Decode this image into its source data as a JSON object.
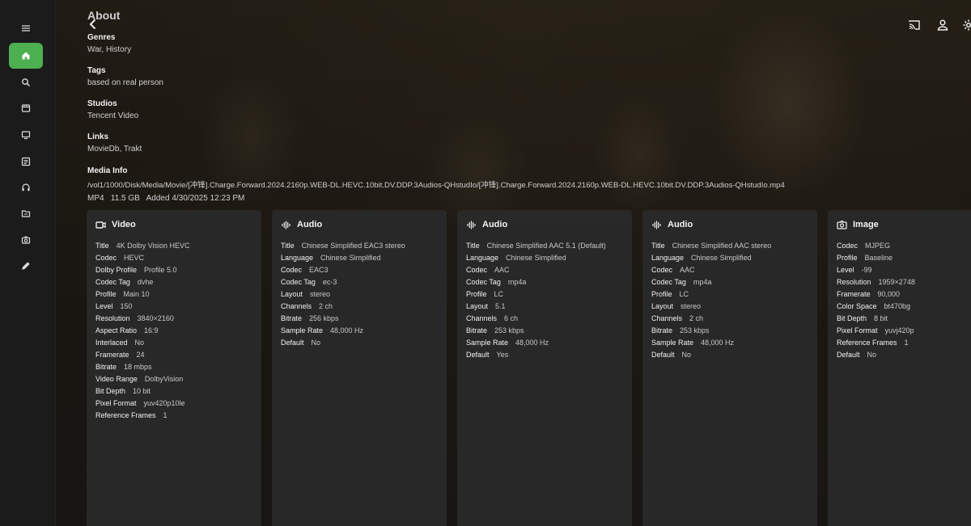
{
  "sidebar": {
    "items": [
      {
        "name": "menu",
        "icon": "menu-icon"
      },
      {
        "name": "home",
        "icon": "home-icon",
        "active": true
      },
      {
        "name": "search",
        "icon": "search-icon"
      },
      {
        "name": "movies",
        "icon": "film-icon"
      },
      {
        "name": "tv",
        "icon": "tv-icon"
      },
      {
        "name": "collections",
        "icon": "list-icon"
      },
      {
        "name": "music",
        "icon": "headphones-icon"
      },
      {
        "name": "folders",
        "icon": "folder-icon"
      },
      {
        "name": "photos",
        "icon": "camera-icon"
      },
      {
        "name": "edit",
        "icon": "pencil-icon"
      }
    ],
    "accent": "#4caf50"
  },
  "header": {
    "title": "About",
    "icons": [
      "cast-icon",
      "user-icon",
      "settings-icon"
    ]
  },
  "about": {
    "genres_label": "Genres",
    "genres_value": "War, History",
    "tags_label": "Tags",
    "tags_value": "based on real person",
    "studios_label": "Studios",
    "studios_value": "Tencent Video",
    "links_label": "Links",
    "links_value": "MovieDb, Trakt",
    "media_info_label": "Media Info",
    "media_path": "/vol1/1000/Disk/Media/Movie/[冲锋].Charge.Forward.2024.2160p.WEB-DL.HEVC.10bit.DV.DDP.3Audios-QHstudIo/[冲锋].Charge.Forward.2024.2160p.WEB-DL.HEVC.10bit.DV.DDP.3Audios-QHstudIo.mp4",
    "media_summary": "MP4   11.5 GB   Added 4/30/2025 12:23 PM"
  },
  "streams": [
    {
      "icon": "video-icon",
      "title": "Video",
      "rows": [
        [
          "Title",
          "4K Dolby Vision HEVC"
        ],
        [
          "Codec",
          "HEVC"
        ],
        [
          "Dolby Profile",
          "Profile 5.0"
        ],
        [
          "Codec Tag",
          "dvhe"
        ],
        [
          "Profile",
          "Main 10"
        ],
        [
          "Level",
          "150"
        ],
        [
          "Resolution",
          "3840×2160"
        ],
        [
          "Aspect Ratio",
          "16:9"
        ],
        [
          "Interlaced",
          "No"
        ],
        [
          "Framerate",
          "24"
        ],
        [
          "Bitrate",
          "18 mbps"
        ],
        [
          "Video Range",
          "DolbyVision"
        ],
        [
          "Bit Depth",
          "10 bit"
        ],
        [
          "Pixel Format",
          "yuv420p10le"
        ],
        [
          "Reference Frames",
          "1"
        ]
      ]
    },
    {
      "icon": "audio-icon",
      "title": "Audio",
      "rows": [
        [
          "Title",
          "Chinese Simplified EAC3 stereo"
        ],
        [
          "Language",
          "Chinese Simplified"
        ],
        [
          "Codec",
          "EAC3"
        ],
        [
          "Codec Tag",
          "ec-3"
        ],
        [
          "Layout",
          "stereo"
        ],
        [
          "Channels",
          "2 ch"
        ],
        [
          "Bitrate",
          "256 kbps"
        ],
        [
          "Sample Rate",
          "48,000 Hz"
        ],
        [
          "Default",
          "No"
        ]
      ]
    },
    {
      "icon": "audio-icon",
      "title": "Audio",
      "rows": [
        [
          "Title",
          "Chinese Simplified AAC 5.1 (Default)"
        ],
        [
          "Language",
          "Chinese Simplified"
        ],
        [
          "Codec",
          "AAC"
        ],
        [
          "Codec Tag",
          "mp4a"
        ],
        [
          "Profile",
          "LC"
        ],
        [
          "Layout",
          "5.1"
        ],
        [
          "Channels",
          "6 ch"
        ],
        [
          "Bitrate",
          "253 kbps"
        ],
        [
          "Sample Rate",
          "48,000 Hz"
        ],
        [
          "Default",
          "Yes"
        ]
      ]
    },
    {
      "icon": "audio-icon",
      "title": "Audio",
      "rows": [
        [
          "Title",
          "Chinese Simplified AAC stereo"
        ],
        [
          "Language",
          "Chinese Simplified"
        ],
        [
          "Codec",
          "AAC"
        ],
        [
          "Codec Tag",
          "mp4a"
        ],
        [
          "Profile",
          "LC"
        ],
        [
          "Layout",
          "stereo"
        ],
        [
          "Channels",
          "2 ch"
        ],
        [
          "Bitrate",
          "253 kbps"
        ],
        [
          "Sample Rate",
          "48,000 Hz"
        ],
        [
          "Default",
          "No"
        ]
      ]
    },
    {
      "icon": "image-icon",
      "title": "Image",
      "rows": [
        [
          "Codec",
          "MJPEG"
        ],
        [
          "Profile",
          "Baseline"
        ],
        [
          "Level",
          "-99"
        ],
        [
          "Resolution",
          "1959×2748"
        ],
        [
          "Framerate",
          "90,000"
        ],
        [
          "Color Space",
          "bt470bg"
        ],
        [
          "Bit Depth",
          "8 bit"
        ],
        [
          "Pixel Format",
          "yuvj420p"
        ],
        [
          "Reference Frames",
          "1"
        ],
        [
          "Default",
          "No"
        ]
      ]
    }
  ]
}
